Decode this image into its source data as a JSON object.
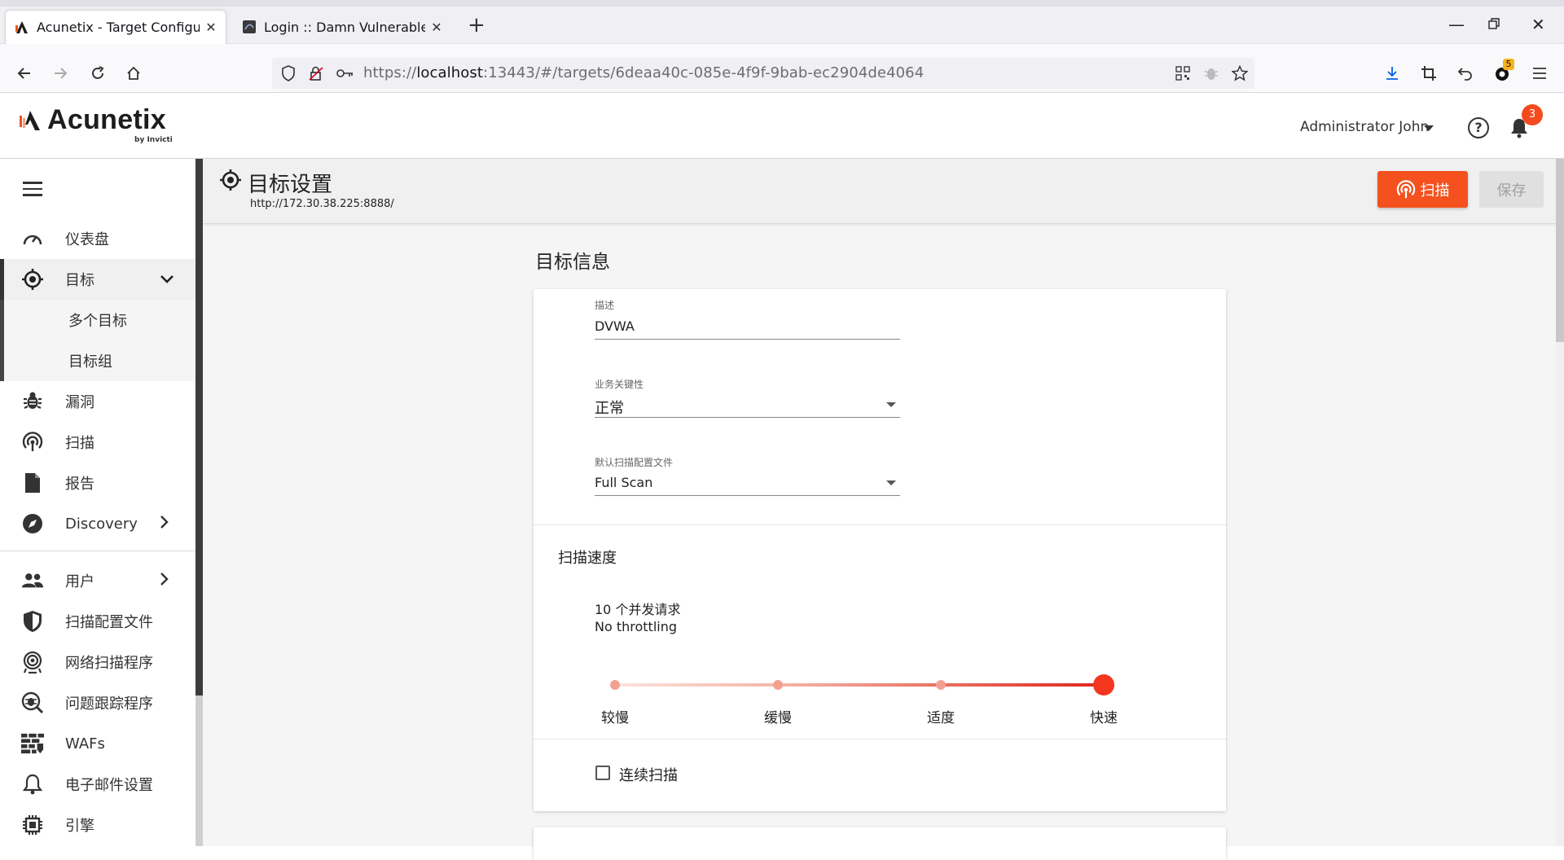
{
  "browser": {
    "tabs": [
      {
        "title": "Acunetix - Target Configurati",
        "active": true
      },
      {
        "title": "Login :: Damn Vulnerable We",
        "active": false
      }
    ],
    "url_prefix": "https://",
    "url_host": "localhost",
    "url_rest": ":13443/#/targets/6deaa40c-085e-4f9f-9bab-ec2904de4064",
    "extension_badge": "5"
  },
  "header": {
    "logo_text": "Acunetix",
    "logo_sub": "by Invicti",
    "user": "Administrator John",
    "notifications": "3"
  },
  "sidebar": {
    "items": [
      {
        "label": "仪表盘",
        "icon": "dashboard-gauge-icon"
      },
      {
        "label": "目标",
        "icon": "target-crosshair-icon",
        "expanded": true
      },
      {
        "label": "多个目标",
        "sub": true
      },
      {
        "label": "目标组",
        "sub": true
      },
      {
        "label": "漏洞",
        "icon": "bug-icon"
      },
      {
        "label": "扫描",
        "icon": "scan-radar-icon"
      },
      {
        "label": "报告",
        "icon": "report-document-icon"
      },
      {
        "label": "Discovery",
        "icon": "compass-icon"
      },
      {
        "label": "用户",
        "icon": "users-icon"
      },
      {
        "label": "扫描配置文件",
        "icon": "shield-icon"
      },
      {
        "label": "网络扫描程序",
        "icon": "network-scanner-icon"
      },
      {
        "label": "问题跟踪程序",
        "icon": "issue-tracker-icon"
      },
      {
        "label": "WAFs",
        "icon": "firewall-icon"
      },
      {
        "label": "电子邮件设置",
        "icon": "bell-settings-icon"
      },
      {
        "label": "引擎",
        "icon": "chip-icon"
      }
    ]
  },
  "page": {
    "title": "目标设置",
    "target_url": "http://172.30.38.225:8888/",
    "scan_button": "扫描",
    "save_button": "保存",
    "section_title": "目标信息",
    "description_label": "描述",
    "description_value": "DVWA",
    "criticality_label": "业务关键性",
    "criticality_value": "正常",
    "profile_label": "默认扫描配置文件",
    "profile_value": "Full Scan",
    "speed_title": "扫描速度",
    "speed_desc1": "10 个并发请求",
    "speed_desc2": "No throttling",
    "speed_levels": [
      "较慢",
      "缓慢",
      "适度",
      "快速"
    ],
    "speed_selected": "快速",
    "continuous_label": "连续扫描",
    "continuous_checked": false
  },
  "colors": {
    "accent": "#f4511e",
    "slider_knob": "#f4361e"
  }
}
